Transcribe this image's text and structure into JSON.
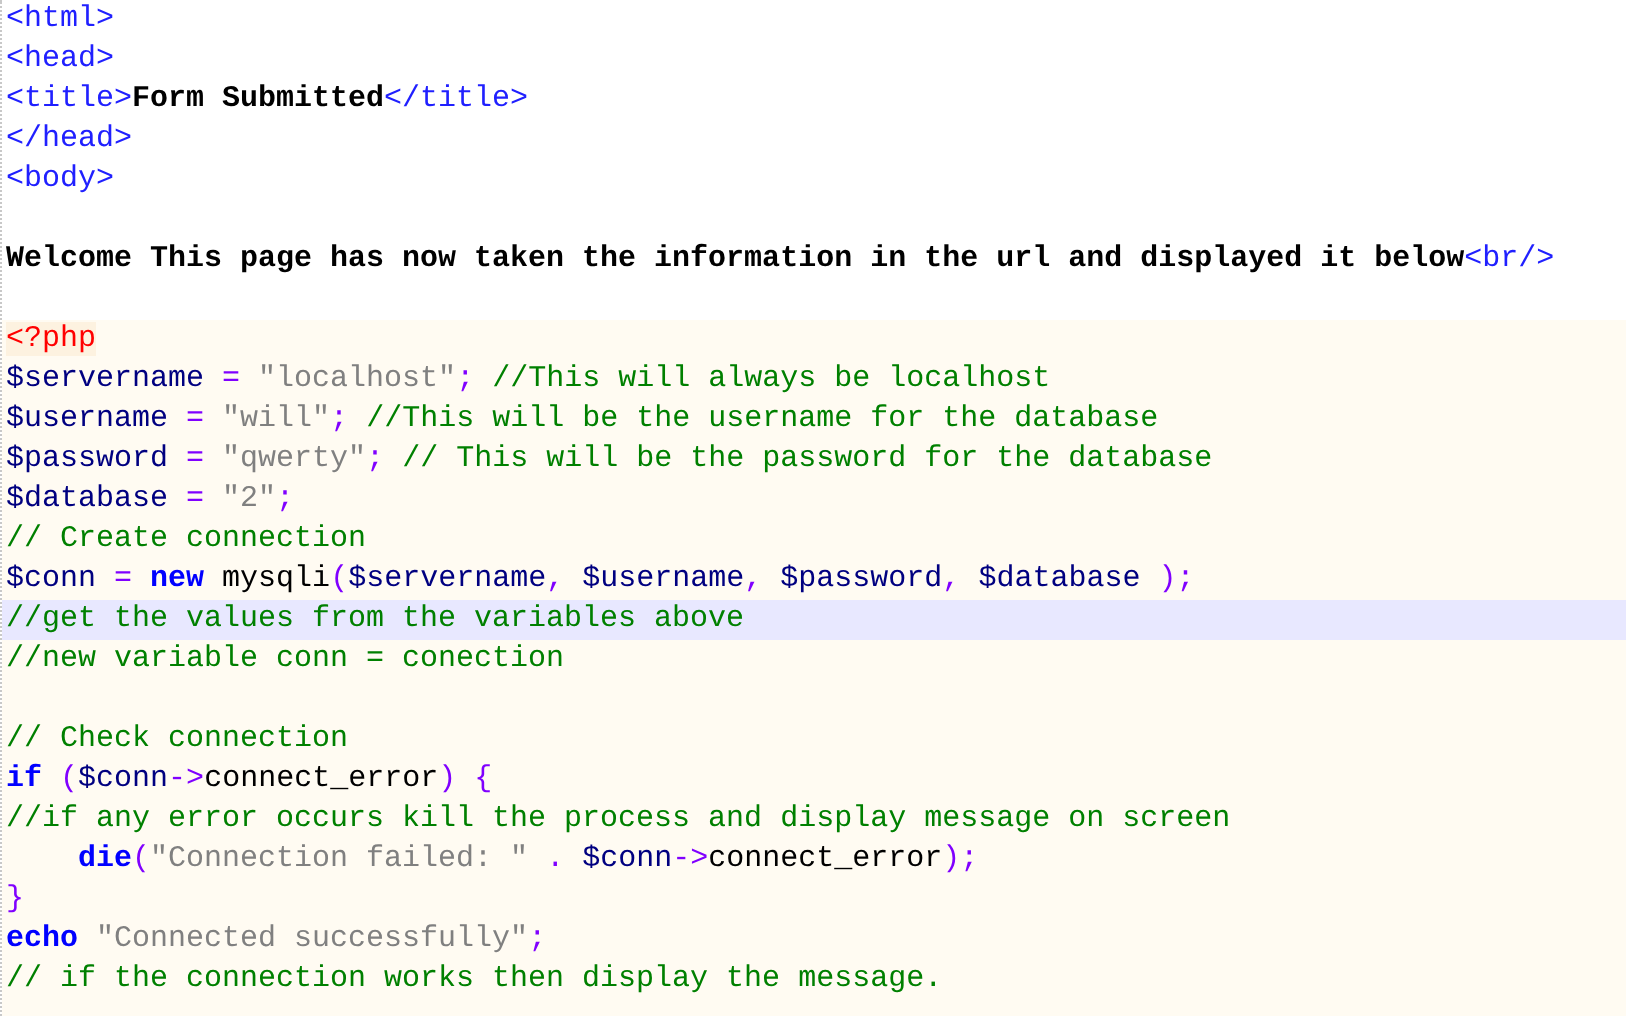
{
  "editor": {
    "sections": [
      {
        "kind": "markup",
        "lines": [
          {
            "current": false,
            "tokens": [
              {
                "kind": "tag",
                "text": "<html>"
              }
            ]
          },
          {
            "current": false,
            "tokens": [
              {
                "kind": "tag",
                "text": "<head>"
              }
            ]
          },
          {
            "current": false,
            "tokens": [
              {
                "kind": "tag",
                "text": "<title>"
              },
              {
                "kind": "text",
                "text": "Form Submitted"
              },
              {
                "kind": "tag",
                "text": "</title>"
              }
            ]
          },
          {
            "current": false,
            "tokens": [
              {
                "kind": "tag",
                "text": "</head>"
              }
            ]
          },
          {
            "current": false,
            "tokens": [
              {
                "kind": "tag",
                "text": "<body>"
              }
            ]
          },
          {
            "current": false
          },
          {
            "current": false,
            "tokens": [
              {
                "kind": "text",
                "text": "Welcome This page has now taken the information in the url and displayed it below"
              },
              {
                "kind": "tag",
                "text": "<br/>"
              }
            ]
          },
          {
            "current": false
          }
        ]
      },
      {
        "kind": "php",
        "lines": [
          {
            "current": false,
            "tokens": [
              {
                "kind": "php_tag",
                "text": "<?php"
              }
            ]
          },
          {
            "current": false,
            "tokens": [
              {
                "kind": "variable",
                "text": "$servername"
              },
              {
                "kind": "operator",
                "text": " = "
              },
              {
                "kind": "string",
                "text": "\"localhost\""
              },
              {
                "kind": "operator",
                "text": ";"
              },
              {
                "kind": "comment",
                "text": " //This will always be localhost"
              }
            ]
          },
          {
            "current": false,
            "tokens": [
              {
                "kind": "variable",
                "text": "$username"
              },
              {
                "kind": "operator",
                "text": " = "
              },
              {
                "kind": "string",
                "text": "\"will\""
              },
              {
                "kind": "operator",
                "text": ";"
              },
              {
                "kind": "comment",
                "text": " //This will be the username for the database"
              }
            ]
          },
          {
            "current": false,
            "tokens": [
              {
                "kind": "variable",
                "text": "$password"
              },
              {
                "kind": "operator",
                "text": " = "
              },
              {
                "kind": "string",
                "text": "\"qwerty\""
              },
              {
                "kind": "operator",
                "text": ";"
              },
              {
                "kind": "comment",
                "text": " // This will be the password for the database"
              }
            ]
          },
          {
            "current": false,
            "tokens": [
              {
                "kind": "variable",
                "text": "$database"
              },
              {
                "kind": "operator",
                "text": " = "
              },
              {
                "kind": "string",
                "text": "\"2\""
              },
              {
                "kind": "operator",
                "text": ";"
              }
            ]
          },
          {
            "current": false,
            "tokens": [
              {
                "kind": "comment",
                "text": "// Create connection"
              }
            ]
          },
          {
            "current": false,
            "tokens": [
              {
                "kind": "variable",
                "text": "$conn"
              },
              {
                "kind": "operator",
                "text": " = "
              },
              {
                "kind": "keyword",
                "text": "new"
              },
              {
                "kind": "plain",
                "text": " mysqli"
              },
              {
                "kind": "operator",
                "text": "("
              },
              {
                "kind": "variable",
                "text": "$servername"
              },
              {
                "kind": "operator",
                "text": ", "
              },
              {
                "kind": "variable",
                "text": "$username"
              },
              {
                "kind": "operator",
                "text": ", "
              },
              {
                "kind": "variable",
                "text": "$password"
              },
              {
                "kind": "operator",
                "text": ", "
              },
              {
                "kind": "variable",
                "text": "$database"
              },
              {
                "kind": "operator",
                "text": " );"
              }
            ]
          },
          {
            "current": true,
            "tokens": [
              {
                "kind": "comment",
                "text": "//get the values from the variables above"
              }
            ]
          },
          {
            "current": false,
            "tokens": [
              {
                "kind": "comment",
                "text": "//new variable conn = conection"
              }
            ]
          },
          {
            "current": false
          },
          {
            "current": false,
            "tokens": [
              {
                "kind": "comment",
                "text": "// Check connection"
              }
            ]
          },
          {
            "current": false,
            "tokens": [
              {
                "kind": "keyword",
                "text": "if"
              },
              {
                "kind": "operator",
                "text": " ("
              },
              {
                "kind": "variable",
                "text": "$conn"
              },
              {
                "kind": "operator",
                "text": "->"
              },
              {
                "kind": "plain",
                "text": "connect_error"
              },
              {
                "kind": "operator",
                "text": ") {"
              }
            ]
          },
          {
            "current": false,
            "tokens": [
              {
                "kind": "comment",
                "text": "//if any error occurs kill the process and display message on screen"
              }
            ]
          },
          {
            "current": false,
            "tokens": [
              {
                "kind": "keyword",
                "text": "    die"
              },
              {
                "kind": "operator",
                "text": "("
              },
              {
                "kind": "string",
                "text": "\"Connection failed: \""
              },
              {
                "kind": "operator",
                "text": " . "
              },
              {
                "kind": "variable",
                "text": "$conn"
              },
              {
                "kind": "operator",
                "text": "->"
              },
              {
                "kind": "plain",
                "text": "connect_error"
              },
              {
                "kind": "operator",
                "text": ");"
              }
            ]
          },
          {
            "current": false,
            "tokens": [
              {
                "kind": "operator",
                "text": "}"
              }
            ]
          },
          {
            "current": false,
            "tokens": [
              {
                "kind": "keyword",
                "text": "echo"
              },
              {
                "kind": "string",
                "text": " \"Connected successfully\""
              },
              {
                "kind": "operator",
                "text": ";"
              }
            ]
          },
          {
            "current": false,
            "tokens": [
              {
                "kind": "comment",
                "text": "// if the connection works then display the message."
              }
            ]
          }
        ]
      }
    ]
  }
}
